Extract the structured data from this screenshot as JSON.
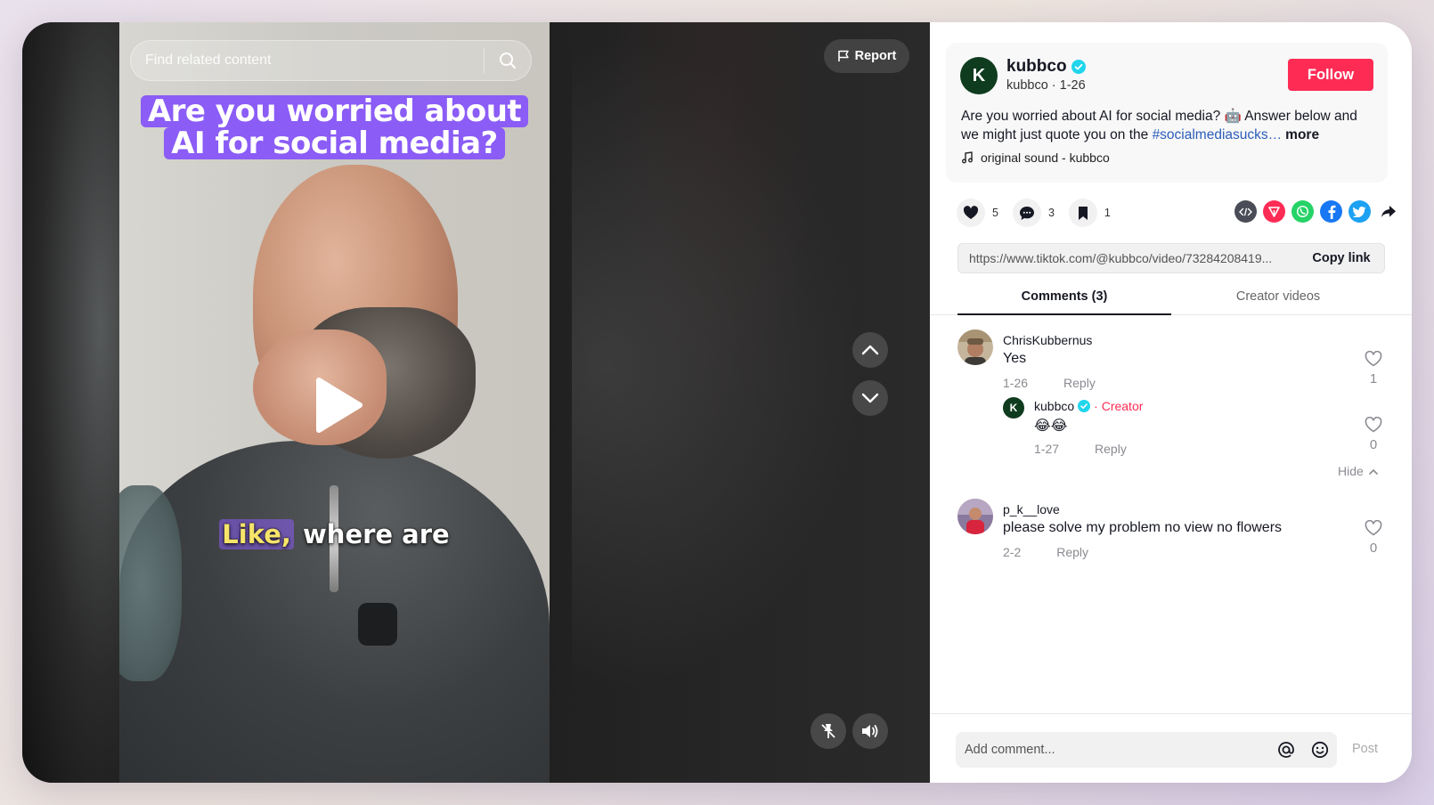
{
  "search": {
    "placeholder": "Find related content"
  },
  "video": {
    "caption_line1": "Are you worried about",
    "caption_line2": "AI for social media?",
    "subtitle_highlight": "Like,",
    "subtitle_rest": " where are",
    "report_label": "Report"
  },
  "creator": {
    "avatar_letter": "K",
    "name": "kubbco",
    "handle": "kubbco",
    "date": "1-26",
    "follow_label": "Follow"
  },
  "description": {
    "text": "Are you worried about AI for social media? 🤖 Answer below and we might just quote you on the ",
    "hashtag": "#socialmediasucks…",
    "more_label": "more"
  },
  "sound": {
    "label": "original sound - kubbco"
  },
  "actions": {
    "likes": "5",
    "comments": "3",
    "saves": "1"
  },
  "share_icons": [
    "embed-icon",
    "send-icon",
    "whatsapp-icon",
    "facebook-icon",
    "twitter-icon",
    "share-arrow-icon"
  ],
  "link": {
    "url": "https://www.tiktok.com/@kubbco/video/73284208419...",
    "copy_label": "Copy link"
  },
  "tabs": [
    {
      "label": "Comments (3)"
    },
    {
      "label": "Creator videos"
    }
  ],
  "comments": [
    {
      "user": "ChrisKubbernus",
      "text": "Yes",
      "date": "1-26",
      "reply_label": "Reply",
      "likes": "1"
    },
    {
      "user": "kubbco",
      "creator_tag": "· Creator",
      "text": "😂😂",
      "date": "1-27",
      "reply_label": "Reply",
      "likes": "0"
    },
    {
      "user": "p_k__love",
      "text": "please solve my problem no view no flowers",
      "date": "2-2",
      "reply_label": "Reply",
      "likes": "0"
    }
  ],
  "hide_label": "Hide",
  "composer": {
    "placeholder": "Add comment...",
    "post_label": "Post"
  },
  "colors": {
    "accent": "#fe2c55",
    "caption_bg": "#8b5cf6",
    "hashtag": "#2b5db9",
    "verified": "#20d5ec"
  }
}
